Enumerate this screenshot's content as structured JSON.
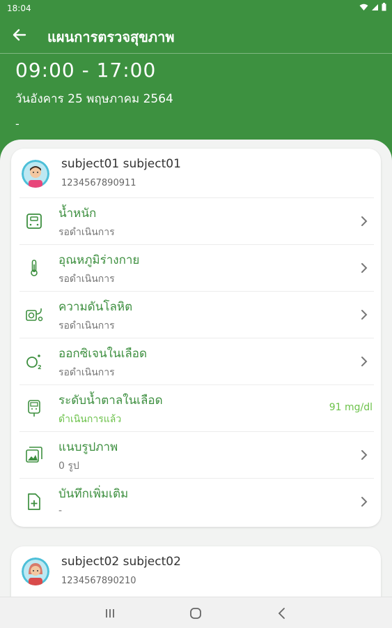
{
  "status_bar": {
    "time": "18:04"
  },
  "app_bar": {
    "title": "แผนการตรวจสุขภาพ"
  },
  "schedule": {
    "time_range": "09:00 - 17:00",
    "date": "วันอังคาร 25 พฤษภาคม 2564",
    "note": "-"
  },
  "colors": {
    "primary": "#3d9140",
    "accent_green": "#6cc24a",
    "background": "#f2f3f2"
  },
  "subjects": [
    {
      "name": "subject01 subject01",
      "id": "1234567890911",
      "items": [
        {
          "icon": "weight-scale-icon",
          "title": "น้ำหนัก",
          "status": "รอดำเนินการ",
          "value": ""
        },
        {
          "icon": "thermometer-icon",
          "title": "อุณหภูมิร่างกาย",
          "status": "รอดำเนินการ",
          "value": ""
        },
        {
          "icon": "blood-pressure-icon",
          "title": "ความดันโลหิต",
          "status": "รอดำเนินการ",
          "value": ""
        },
        {
          "icon": "oxygen-icon",
          "title": "ออกซิเจนในเลือด",
          "status": "รอดำเนินการ",
          "value": ""
        },
        {
          "icon": "glucose-meter-icon",
          "title": "ระดับน้ำตาลในเลือด",
          "status": "ดำเนินการแล้ว",
          "value": "91 mg/dl"
        },
        {
          "icon": "image-icon",
          "title": "แนบรูปภาพ",
          "status": "0 รูป",
          "value": ""
        },
        {
          "icon": "note-add-icon",
          "title": "บันทึกเพิ่มเติม",
          "status": "-",
          "value": ""
        }
      ]
    },
    {
      "name": "subject02 subject02",
      "id": "1234567890210"
    }
  ]
}
